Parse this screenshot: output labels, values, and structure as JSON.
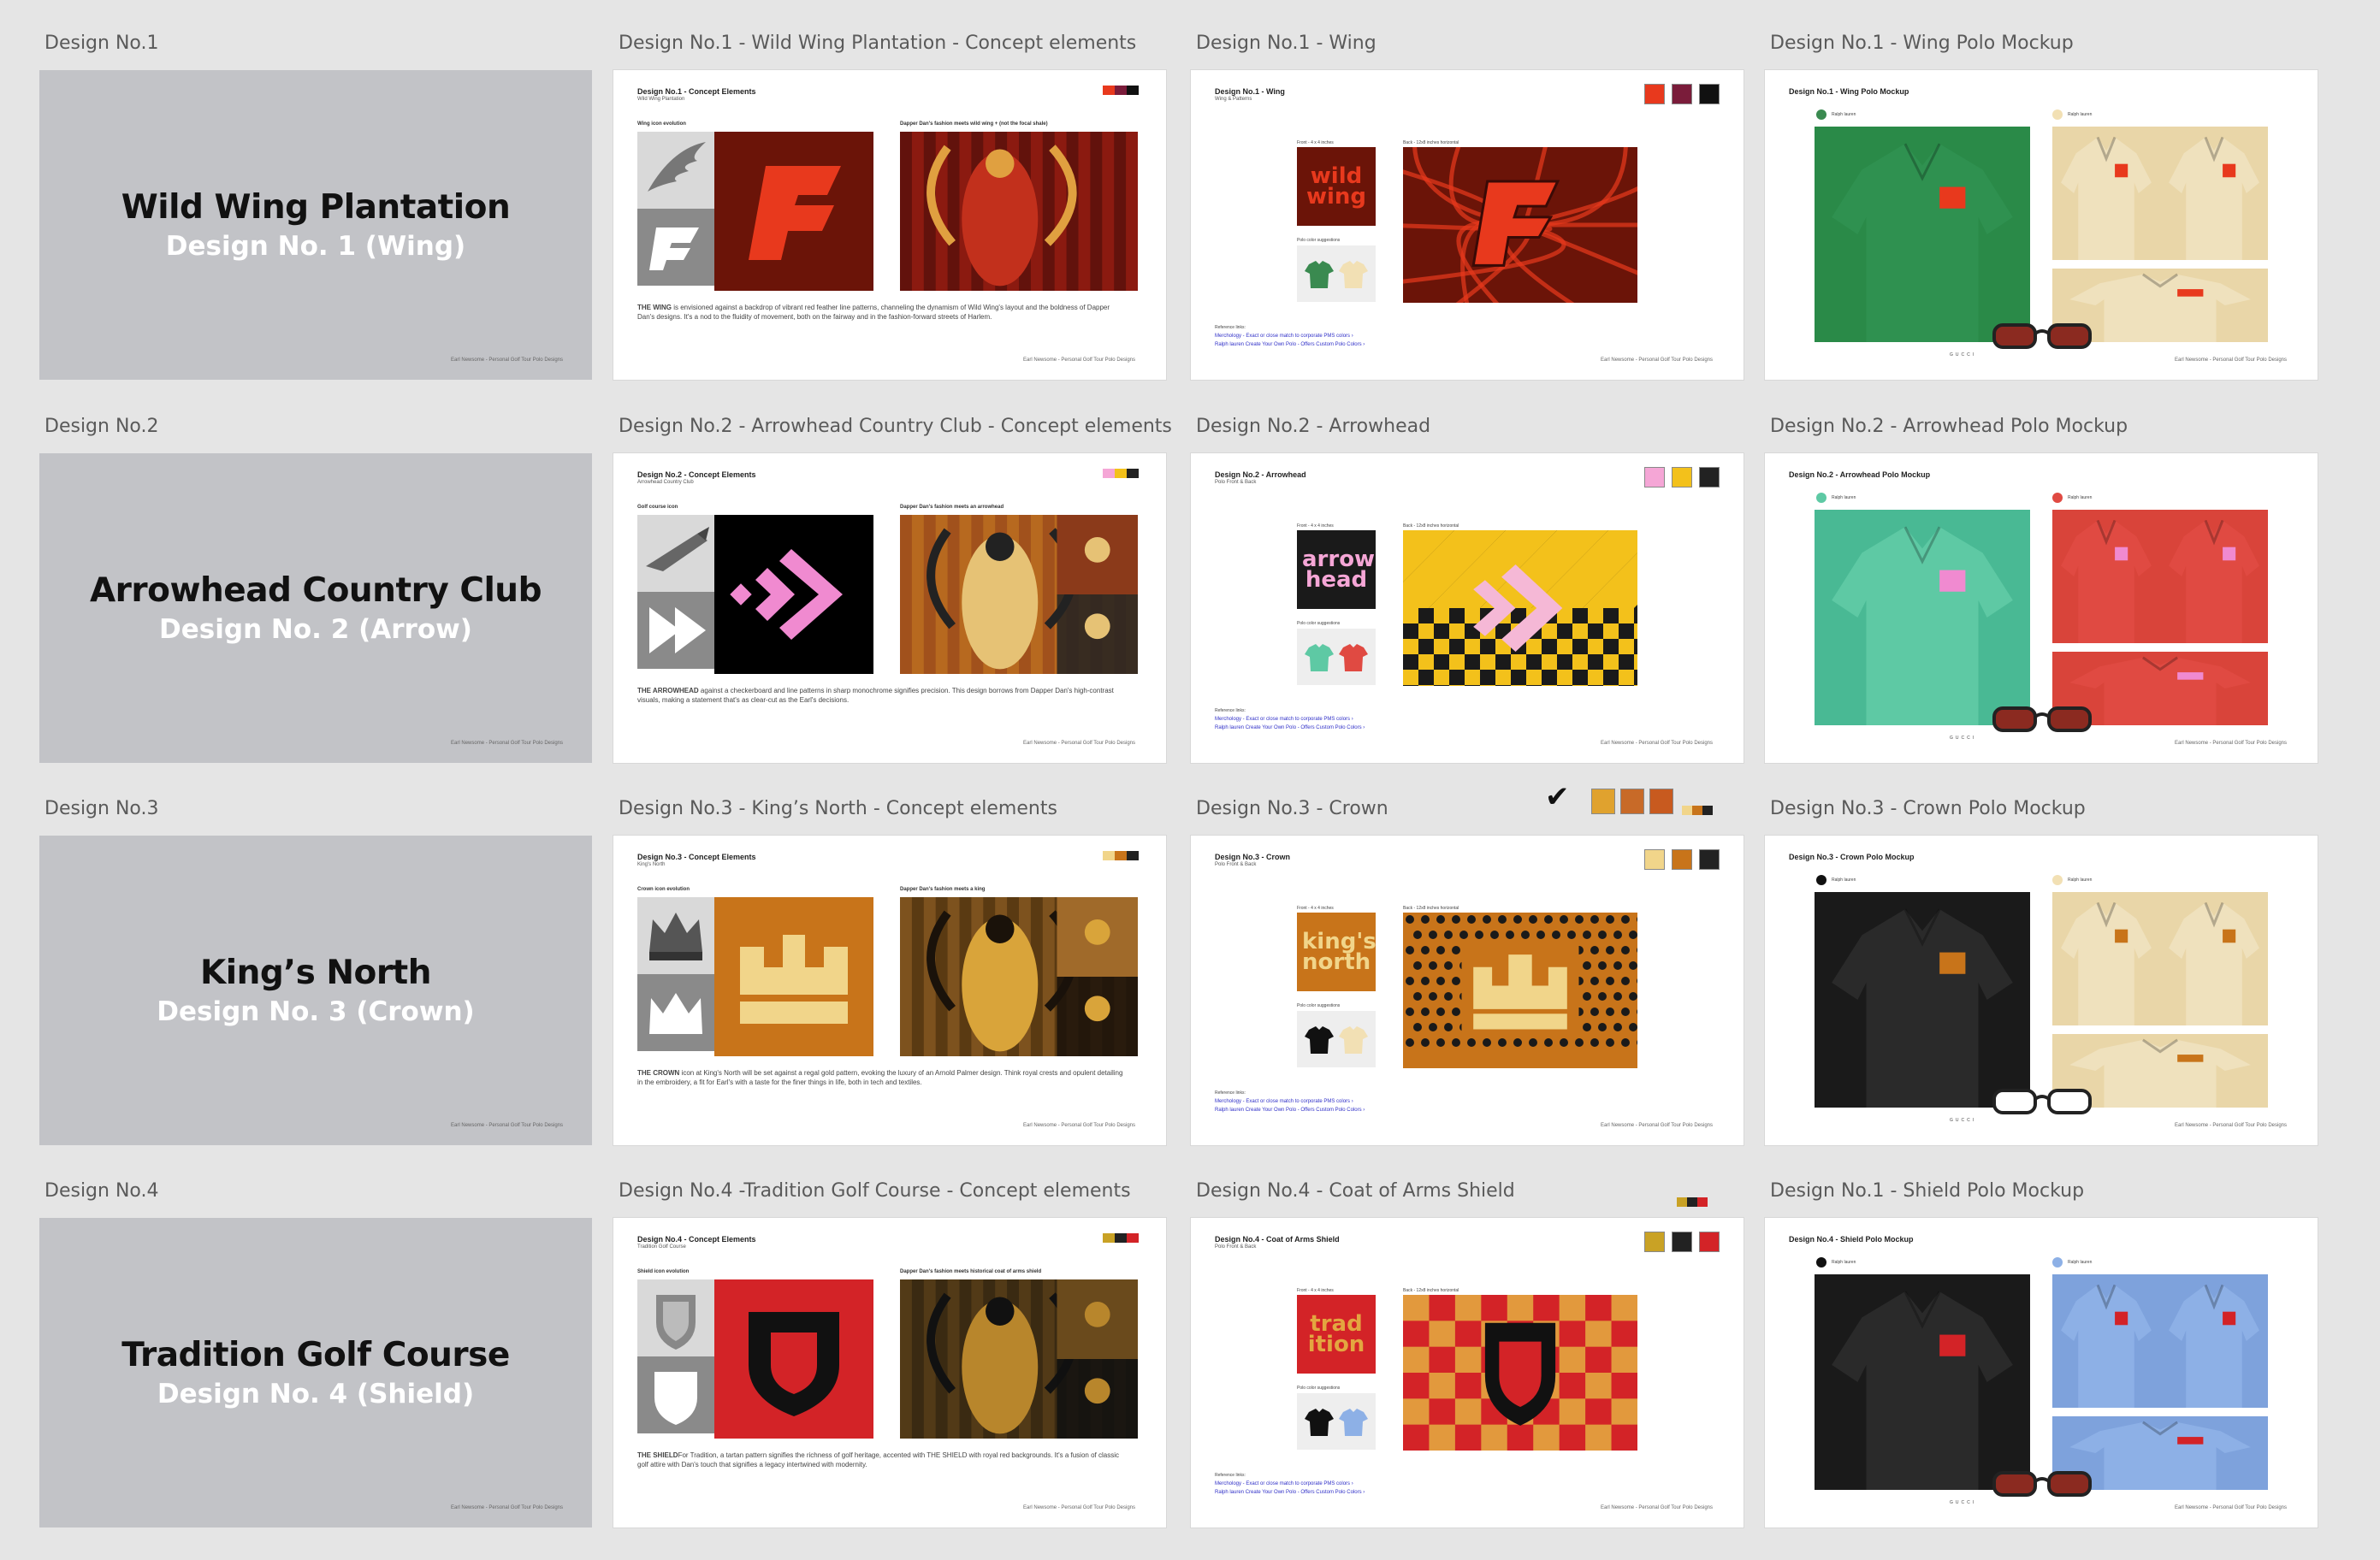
{
  "rows": [
    {
      "row_label": "Design No.1",
      "cover_title": "Wild Wing Plantation",
      "cover_sub": "Design No. 1 (Wing)",
      "concept_label": "Design No.1 - Wild Wing Plantation - Concept elements",
      "detail_label": "Design No.1 - Wing",
      "mockup_label": "Design No.1 -  Wing Polo Mockup",
      "concept_title": "Design No.1 - Concept Elements",
      "concept_sub": "Wild Wing Plantation",
      "icon_evolution": "Wing icon evolution",
      "fashion_label": "Dapper Dan's fashion meets wild wing + (not the focal shale)",
      "caption_bold": "THE WING",
      "caption": " is envisioned against a backdrop of vibrant red feather line patterns, channeling the dynamism of Wild Wing's layout and the boldness of Dapper Dan's designs. It's a nod to the fluidity of movement, both on the fairway and in the fashion-forward streets of Harlem.",
      "detail_title": "Design No.1 - Wing",
      "detail_sub": "Wing & Patterns",
      "wordmark": "wild wing",
      "mockup_title": "Design No.1 - Wing Polo Mockup"
    },
    {
      "row_label": "Design No.2",
      "cover_title": "Arrowhead Country Club",
      "cover_sub": "Design No. 2 (Arrow)",
      "concept_label": "Design No.2 - Arrowhead Country Club - Concept elements",
      "detail_label": "Design No.2 - Arrowhead",
      "mockup_label": "Design No.2 -  Arrowhead Polo Mockup",
      "concept_title": "Design No.2 - Concept Elements",
      "concept_sub": "Arrowhead Country Club",
      "icon_evolution": "Golf course icon",
      "fashion_label": "Dapper Dan's fashion meets an arrowhead",
      "caption_bold": "THE ARROWHEAD",
      "caption": " against a checkerboard and line patterns in sharp monochrome signifies precision. This design borrows from Dapper Dan's high-contrast visuals, making a statement that's as clear-cut as the Earl's decisions.",
      "detail_title": "Design No.2 - Arrowhead",
      "detail_sub": "Polo Front & Back",
      "wordmark": "arrow head",
      "mockup_title": "Design No.2 - Arrowhead Polo Mockup"
    },
    {
      "row_label": "Design No.3",
      "cover_title": "King’s North",
      "cover_sub": "Design No. 3 (Crown)",
      "concept_label": "Design No.3 - King’s North - Concept elements",
      "detail_label": "Design No.3 - Crown",
      "mockup_label": "Design No.3 -  Crown Polo Mockup",
      "concept_title": "Design No.3 - Concept Elements",
      "concept_sub": "King's North",
      "icon_evolution": "Crown icon evolution",
      "fashion_label": "Dapper Dan's fashion meets a king",
      "caption_bold": "THE CROWN",
      "caption": " icon at King's North will be set against a regal gold pattern, evoking the luxury of an Arnold Palmer design. Think royal crests and opulent detailing in the embroidery, a fit for Earl's with a taste for the finer things in life, both in tech and textiles.",
      "detail_title": "Design No.3 - Crown",
      "detail_sub": "Polo Front & Back",
      "wordmark": "king's north",
      "mockup_title": "Design No.3 - Crown Polo Mockup"
    },
    {
      "row_label": "Design No.4",
      "cover_title": "Tradition Golf Course",
      "cover_sub": "Design No. 4 (Shield)",
      "concept_label": "Design No.4 -Tradition Golf Course - Concept elements",
      "detail_label": "Design No.4 - Coat of Arms Shield",
      "mockup_label": "Design No.1 -  Shield Polo Mockup",
      "concept_title": "Design No.4 - Concept Elements",
      "concept_sub": "Tradition Golf Course",
      "icon_evolution": "Shield icon evolution",
      "fashion_label": "Dapper Dan's fashion meets historical coat of arms shield",
      "caption_bold": "THE SHIELD",
      "caption": "For Tradition, a tartan pattern signifies the richness of golf heritage, accented with THE SHIELD with royal red backgrounds. It's a fusion of classic golf attire with Dan's touch that signifies a legacy intertwined with modernity.",
      "detail_title": "Design No.4 - Coat of Arms Shield",
      "detail_sub": "Polo Front & Back",
      "wordmark": "trad ition",
      "mockup_title": "Design No.4 - Shield Polo Mockup"
    }
  ],
  "common": {
    "footer": "Earl Newsome - Personal Golf Tour Polo Designs",
    "front_label": "Front - 4 x 4 inches",
    "back_label": "Back - 12x8 inches horizontal",
    "polo_colors": "Polo color suggestions",
    "reference_links": "Reference links:",
    "link1": "Merchology - Exact or close match to corporate PMS colors ›",
    "link2": "Ralph lauren Create Your Own Polo - Offers Custom Polo Colors ›",
    "brand": "GUCCI",
    "ralph": "Ralph lauren",
    "checkmark": "✔"
  },
  "colors": {
    "wing_red": "#e8391d",
    "wing_dark": "#6b1408",
    "arrow_pink": "#f08ad0",
    "arrow_yellow": "#f3c11b",
    "crown_orange": "#c8741a",
    "crown_cream": "#f1d58a",
    "shield_red": "#d32327",
    "shield_black": "#1a1a1a",
    "green_polo": "#2f9150",
    "teal_polo": "#5ec9a4",
    "cream_polo": "#efe1bd",
    "red_polo": "#e04a42",
    "black_polo": "#2a2a2a",
    "blue_polo": "#8db0e6"
  }
}
